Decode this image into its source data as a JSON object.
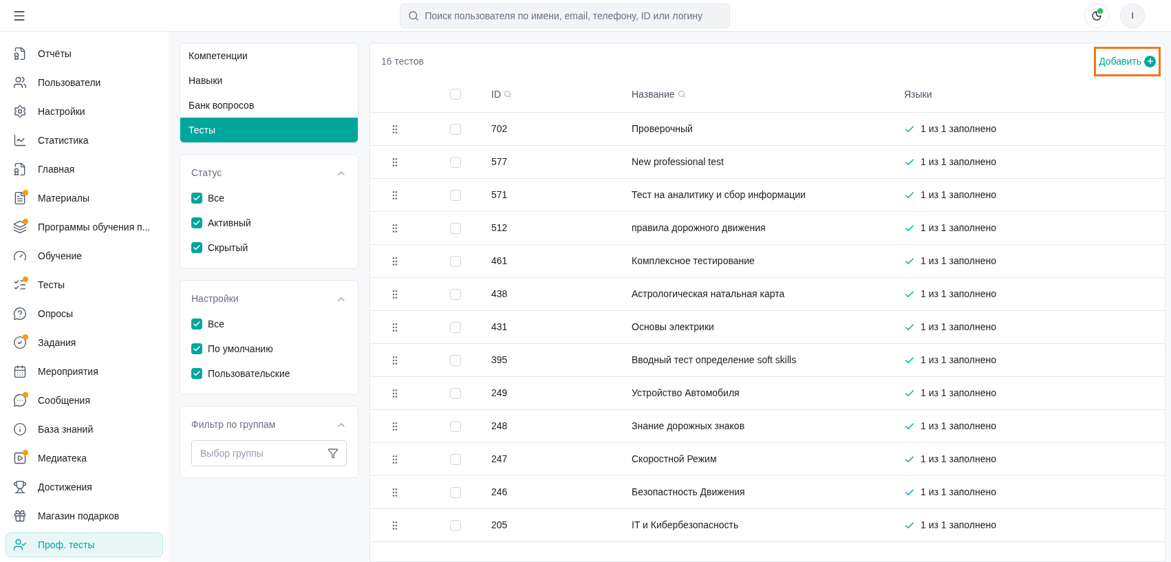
{
  "search": {
    "placeholder": "Поиск пользователя по имени, email, телефону, ID или логину"
  },
  "header": {
    "notification_dot": true,
    "avatar_letter": "I"
  },
  "sidebar": {
    "items": [
      {
        "label": "Отчёты",
        "dot": false,
        "selected": false
      },
      {
        "label": "Пользователи",
        "dot": false,
        "selected": false
      },
      {
        "label": "Настройки",
        "dot": false,
        "selected": false
      },
      {
        "label": "Статистика",
        "dot": false,
        "selected": false
      },
      {
        "label": "Главная",
        "dot": false,
        "selected": false
      },
      {
        "label": "Материалы",
        "dot": true,
        "selected": false
      },
      {
        "label": "Программы обучения п...",
        "dot": true,
        "selected": false
      },
      {
        "label": "Обучение",
        "dot": false,
        "selected": false
      },
      {
        "label": "Тесты",
        "dot": true,
        "selected": false
      },
      {
        "label": "Опросы",
        "dot": false,
        "selected": false
      },
      {
        "label": "Задания",
        "dot": true,
        "selected": false
      },
      {
        "label": "Мероприятия",
        "dot": false,
        "selected": false
      },
      {
        "label": "Сообщения",
        "dot": true,
        "selected": false
      },
      {
        "label": "База знаний",
        "dot": false,
        "selected": false
      },
      {
        "label": "Медиатека",
        "dot": true,
        "selected": false
      },
      {
        "label": "Достижения",
        "dot": false,
        "selected": false
      },
      {
        "label": "Магазин подарков",
        "dot": false,
        "selected": false
      },
      {
        "label": "Проф. тесты",
        "dot": false,
        "selected": true
      }
    ]
  },
  "sections": [
    {
      "label": "Компетенции",
      "selected": false
    },
    {
      "label": "Навыки",
      "selected": false
    },
    {
      "label": "Банк вопросов",
      "selected": false
    },
    {
      "label": "Тесты",
      "selected": true
    }
  ],
  "filters": [
    {
      "title": "Статус",
      "expanded": true,
      "options": [
        {
          "label": "Все",
          "checked": true
        },
        {
          "label": "Активный",
          "checked": true
        },
        {
          "label": "Скрытый",
          "checked": true
        }
      ]
    },
    {
      "title": "Настройки",
      "expanded": true,
      "options": [
        {
          "label": "Все",
          "checked": true
        },
        {
          "label": "По умолчанию",
          "checked": true
        },
        {
          "label": "Пользовательские",
          "checked": true
        }
      ]
    }
  ],
  "group_filter": {
    "title": "Фильтр по группам",
    "expanded": true,
    "placeholder": "Выбор группы"
  },
  "table": {
    "count": "16 тестов",
    "add_button": {
      "label": "Добавить",
      "highlighted": true
    },
    "all_checked": false,
    "columns": [
      {
        "label": "ID"
      },
      {
        "label": "Название"
      },
      {
        "label": "Языки"
      }
    ],
    "rows": [
      {
        "id": "702",
        "name": "Проверочный",
        "languages": "1 из 1 заполнено",
        "checked": false
      },
      {
        "id": "577",
        "name": "New professional test",
        "languages": "1 из 1 заполнено",
        "checked": false
      },
      {
        "id": "571",
        "name": "Тест на аналитику и сбор информации",
        "languages": "1 из 1 заполнено",
        "checked": false
      },
      {
        "id": "512",
        "name": "правила дорожного движения",
        "languages": "1 из 1 заполнено",
        "checked": false
      },
      {
        "id": "461",
        "name": "Комплексное тестирование",
        "languages": "1 из 1 заполнено",
        "checked": false
      },
      {
        "id": "438",
        "name": "Астрологическая натальная карта",
        "languages": "1 из 1 заполнено",
        "checked": false
      },
      {
        "id": "431",
        "name": "Основы электрики",
        "languages": "1 из 1 заполнено",
        "checked": false
      },
      {
        "id": "395",
        "name": "Вводный тест определение soft skills",
        "languages": "1 из 1 заполнено",
        "checked": false
      },
      {
        "id": "249",
        "name": "Устройство Автомобиля",
        "languages": "1 из 1 заполнено",
        "checked": false
      },
      {
        "id": "248",
        "name": "Знание дорожных знаков",
        "languages": "1 из 1 заполнено",
        "checked": false
      },
      {
        "id": "247",
        "name": "Скоростной Режим",
        "languages": "1 из 1 заполнено",
        "checked": false
      },
      {
        "id": "246",
        "name": "Безопастность Движения",
        "languages": "1 из 1 заполнено",
        "checked": false
      },
      {
        "id": "205",
        "name": "IT и Кибербезопасность",
        "languages": "1 из 1 заполнено",
        "checked": false
      }
    ]
  }
}
